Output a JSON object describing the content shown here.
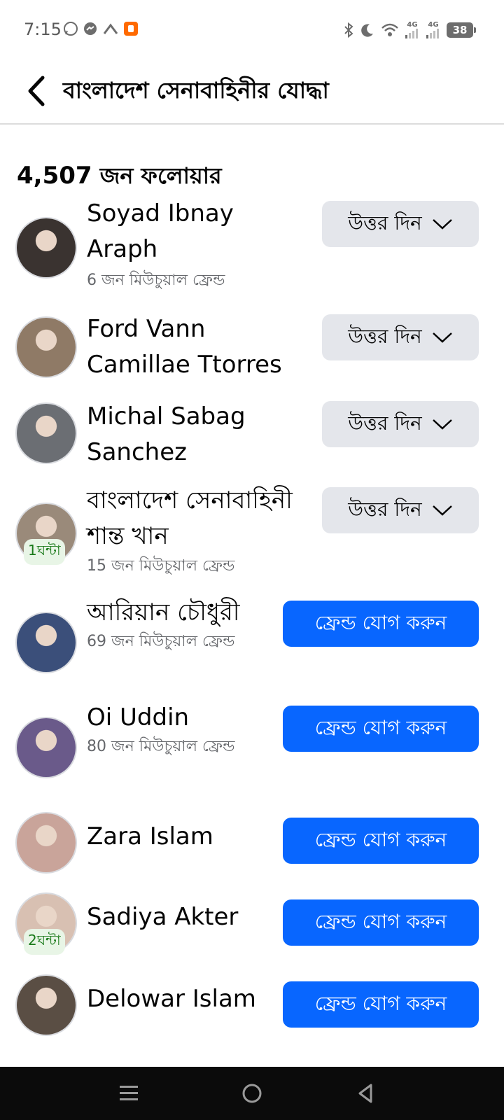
{
  "status_bar": {
    "time": "7:15",
    "battery": "38",
    "net1": "4G",
    "net2": "4G"
  },
  "header": {
    "title": "বাংলাদেশ সেনাবাহিনীর যোদ্ধা"
  },
  "followers": {
    "count": "4,507",
    "label": " জন ফলোয়ার"
  },
  "reply_label": "উত্তর দিন",
  "add_friend_label": "ফ্রেন্ড যোগ করুন",
  "people": [
    {
      "name": "Soyad Ibnay Araph",
      "mutual": "6 জন মিউচুয়াল ফ্রেন্ড",
      "action": "reply",
      "avatar_color": "#3a3330"
    },
    {
      "name": "Ford Vann Camillae Ttorres",
      "mutual": "",
      "action": "reply",
      "avatar_color": "#8f7a66"
    },
    {
      "name": "Michal Sabag Sanchez",
      "mutual": "",
      "action": "reply",
      "avatar_color": "#6b6e73"
    },
    {
      "name": "বাংলাদেশ সেনাবাহিনী শান্ত খান",
      "mutual": "15 জন মিউচুয়াল ফ্রেন্ড",
      "action": "reply",
      "badge": "1ঘন্টা",
      "avatar_color": "#9a8a7a"
    },
    {
      "name": "আরিয়ান চৌধুরী",
      "mutual": "69 জন মিউচুয়াল ফ্রেন্ড",
      "action": "add",
      "avatar_color": "#3b4f7a"
    },
    {
      "name": "Oi Uddin",
      "mutual": "80 জন মিউচুয়াল ফ্রেন্ড",
      "action": "add",
      "avatar_color": "#6a5a8a"
    },
    {
      "name": "Zara Islam",
      "mutual": "",
      "action": "add",
      "avatar_color": "#c9a49a"
    },
    {
      "name": "Sadiya Akter",
      "mutual": "",
      "action": "add",
      "badge": "2ঘন্টা",
      "avatar_color": "#d8c0b2"
    },
    {
      "name": "Delowar Islam",
      "mutual": "",
      "action": "add",
      "avatar_color": "#5a4e44"
    }
  ],
  "colors": {
    "primary_blue": "#0866ff",
    "reply_gray": "#e4e6eb",
    "secondary_text": "#65676b"
  }
}
